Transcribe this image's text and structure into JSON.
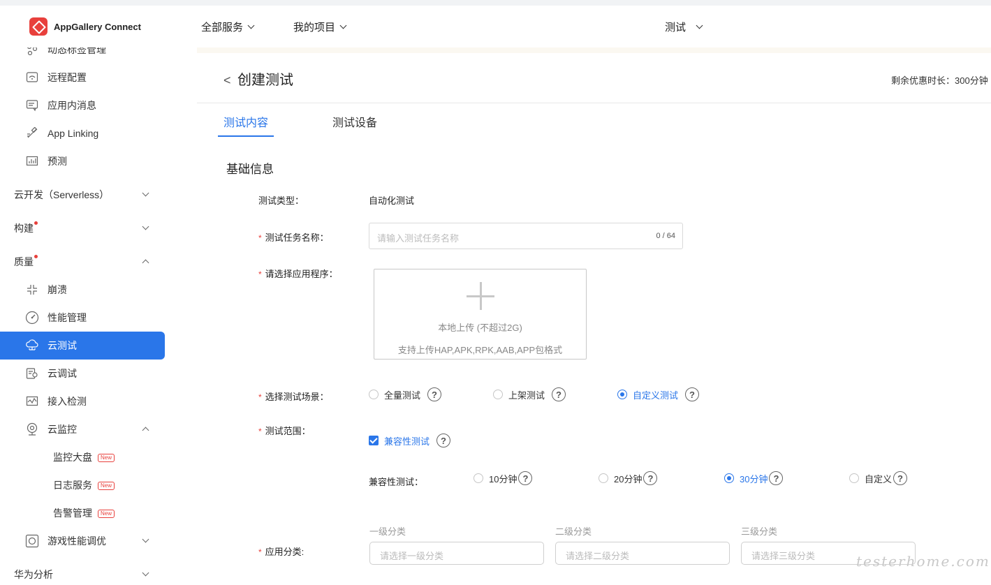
{
  "topbar": {
    "logo_text": "AppGallery Connect",
    "nav": [
      {
        "label": "全部服务"
      },
      {
        "label": "我的项目"
      },
      {
        "label": "测试"
      }
    ]
  },
  "sidebar": {
    "items": [
      {
        "label": "动态标签管理",
        "icon": "tag-icon"
      },
      {
        "label": "远程配置",
        "icon": "remote-config-icon"
      },
      {
        "label": "应用内消息",
        "icon": "message-icon"
      },
      {
        "label": "App Linking",
        "icon": "link-icon"
      },
      {
        "label": "预测",
        "icon": "chart-icon"
      },
      {
        "label": "云开发（Serverless）"
      },
      {
        "label": "构建"
      },
      {
        "label": "质量"
      },
      {
        "label": "崩溃",
        "icon": "crash-icon"
      },
      {
        "label": "性能管理",
        "icon": "gauge-icon"
      },
      {
        "label": "云测试",
        "icon": "cloud-test-icon"
      },
      {
        "label": "云调试",
        "icon": "cloud-debug-icon"
      },
      {
        "label": "接入检测",
        "icon": "access-check-icon"
      },
      {
        "label": "云监控",
        "icon": "monitor-icon"
      },
      {
        "label": "监控大盘",
        "badge": "New"
      },
      {
        "label": "日志服务",
        "badge": "New"
      },
      {
        "label": "告警管理",
        "badge": "New"
      },
      {
        "label": "游戏性能调优",
        "icon": "game-icon"
      },
      {
        "label": "华为分析"
      }
    ]
  },
  "main": {
    "back": "<",
    "title": "创建测试",
    "quota": "剩余优惠时长：300分钟",
    "tabs": [
      {
        "label": "测试内容"
      },
      {
        "label": "测试设备"
      }
    ],
    "section_title": "基础信息",
    "form": {
      "type_label": "测试类型：",
      "type_value": "自动化测试",
      "name_label": "测试任务名称：",
      "name_placeholder": "请输入测试任务名称",
      "name_count": "0 / 64",
      "app_label": "请选择应用程序：",
      "upload_line1": "本地上传 (不超过2G)",
      "upload_line2": "支持上传HAP,APK,RPK,AAB,APP包格式",
      "scene_label": "选择测试场景：",
      "scenes": [
        {
          "label": "全量测试",
          "selected": false
        },
        {
          "label": "上架测试",
          "selected": false
        },
        {
          "label": "自定义测试",
          "selected": true
        }
      ],
      "range_label": "测试范围：",
      "range_check": "兼容性测试",
      "compat_label": "兼容性测试：",
      "durations": [
        {
          "label": "10分钟",
          "selected": false
        },
        {
          "label": "20分钟",
          "selected": false
        },
        {
          "label": "30分钟",
          "selected": true
        },
        {
          "label": "自定义",
          "selected": false
        }
      ],
      "category_label": "应用分类:",
      "categories": [
        {
          "title": "一级分类",
          "placeholder": "请选择一级分类"
        },
        {
          "title": "二级分类",
          "placeholder": "请选择二级分类"
        },
        {
          "title": "三级分类",
          "placeholder": "请选择三级分类"
        }
      ]
    }
  },
  "watermark": "testerhome.com",
  "colors": {
    "accent": "#2a76e9",
    "required": "#e8403c",
    "brand": "#e8403c"
  }
}
